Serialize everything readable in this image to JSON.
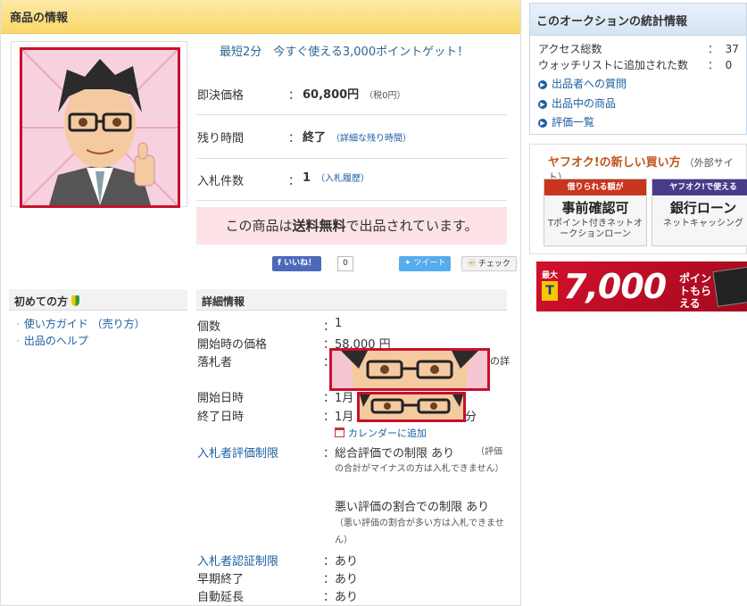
{
  "main": {
    "header": "商品の情報",
    "promo": "最短2分　今すぐ使える3,000ポイントゲット！",
    "info": [
      {
        "label": "即決価格",
        "colon": "：",
        "value": "60,800円",
        "sub": "（税0円）"
      },
      {
        "label": "残り時間",
        "colon": "：",
        "value": "終了",
        "sub": "（詳細な残り時間）"
      },
      {
        "label": "入札件数",
        "colon": "：",
        "value": "1",
        "sub": "（入札履歴）"
      }
    ],
    "shipping": {
      "pre": "この商品は",
      "bold": "送料無料",
      "post": "で出品されています。"
    },
    "social": {
      "like": "いいね！",
      "like_count": "0",
      "tweet": "ツイート",
      "check": "チェック"
    }
  },
  "beginners": {
    "title": "初めての方",
    "links": [
      "使い方ガイド （売り方）",
      "出品のヘルプ"
    ]
  },
  "detail": {
    "title": "詳細情報",
    "rows": {
      "count": {
        "label": "個数",
        "value": "1"
      },
      "start_price": {
        "label": "開始時の価格",
        "value": "58,000 円"
      },
      "winner": {
        "label": "落札者",
        "value_tail": "の詳"
      },
      "start_date": {
        "label": "開始日時",
        "value": "1月"
      },
      "end_date": {
        "label": "終了日時",
        "value": "1月",
        "value_tail": "分"
      },
      "calendar": "カレンダーに追加",
      "bidder_rating": {
        "label": "入札者評価制限",
        "value": "総合評価での制限 あり",
        "note": "（評価の合計がマイナスの方は入札できません）",
        "value2": "悪い評価の割合での制限 あり",
        "note2": "（悪い評価の割合が多い方は入札できません）"
      },
      "bidder_auth": {
        "label": "入札者認証制限",
        "value": "あり"
      },
      "early_end": {
        "label": "早期終了",
        "value": "あり"
      },
      "auto_extend": {
        "label": "自動延長",
        "value": "あり"
      }
    },
    "colon": "："
  },
  "stats": {
    "header": "このオークションの統計情報",
    "access_label": "アクセス総数",
    "access_colon": "：",
    "access_value": "37",
    "watch_label": "ウォッチリストに追加された数",
    "watch_colon": "：",
    "watch_value": "0",
    "links": [
      "出品者への質問",
      "出品中の商品",
      "評価一覧"
    ]
  },
  "newbuy": {
    "title": "ヤフオク!の新しい買い方",
    "sub": "（外部サイト）",
    "card1": {
      "top": "借りられる額が",
      "main": "事前確認可",
      "sub": "Tポイント付きネットオークションローン"
    },
    "card2": {
      "top": "ヤフオク!で使える",
      "main": "銀行ローン",
      "sub": "ネットキャッシング"
    }
  },
  "banner": {
    "pre": "最大",
    "tmark": "T",
    "big": "7,000",
    "unit": "ポイントもらえる"
  },
  "colors": {
    "accent_red": "#c8102e",
    "link": "#1a5fa3",
    "header_yellow": "#f9d86a",
    "shipping_pink": "#fde3e7"
  }
}
